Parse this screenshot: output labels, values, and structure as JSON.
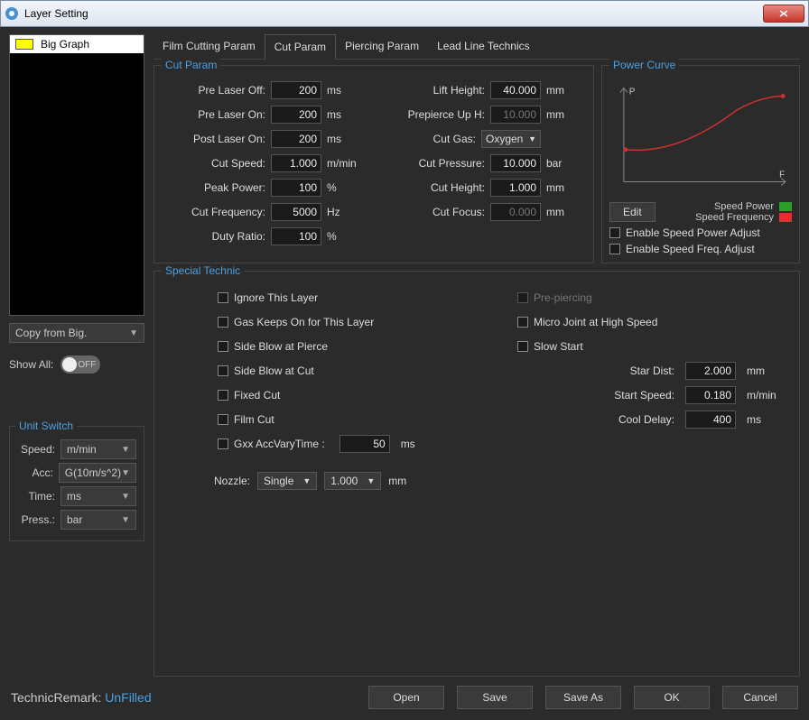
{
  "window": {
    "title": "Layer Setting",
    "close": "X"
  },
  "sidebar": {
    "layer_name": "Big Graph",
    "layer_color": "#ffff00",
    "copy_from": "Copy from Big.",
    "show_all_label": "Show All:",
    "show_all_state": "OFF",
    "unit_switch_legend": "Unit Switch",
    "units": {
      "speed_label": "Speed:",
      "speed_value": "m/min",
      "acc_label": "Acc:",
      "acc_value": "G(10m/s^2)",
      "time_label": "Time:",
      "time_value": "ms",
      "press_label": "Press.:",
      "press_value": "bar"
    }
  },
  "tabs": {
    "t0": "Film Cutting Param",
    "t1": "Cut Param",
    "t2": "Piercing Param",
    "t3": "Lead Line Technics"
  },
  "cut_param": {
    "legend": "Cut Param",
    "left": {
      "pre_laser_off": {
        "label": "Pre Laser Off:",
        "value": "200",
        "unit": "ms"
      },
      "pre_laser_on": {
        "label": "Pre Laser On:",
        "value": "200",
        "unit": "ms"
      },
      "post_laser_on": {
        "label": "Post Laser On:",
        "value": "200",
        "unit": "ms"
      },
      "cut_speed": {
        "label": "Cut Speed:",
        "value": "1.000",
        "unit": "m/min"
      },
      "peak_power": {
        "label": "Peak Power:",
        "value": "100",
        "unit": "%"
      },
      "cut_frequency": {
        "label": "Cut Frequency:",
        "value": "5000",
        "unit": "Hz"
      },
      "duty_ratio": {
        "label": "Duty Ratio:",
        "value": "100",
        "unit": "%"
      }
    },
    "right": {
      "lift_height": {
        "label": "Lift Height:",
        "value": "40.000",
        "unit": "mm"
      },
      "prepierce_up_h": {
        "label": "Prepierce Up H:",
        "value": "10.000",
        "unit": "mm",
        "disabled": true
      },
      "cut_gas": {
        "label": "Cut Gas:",
        "value": "Oxygen"
      },
      "cut_pressure": {
        "label": "Cut Pressure:",
        "value": "10.000",
        "unit": "bar"
      },
      "cut_height": {
        "label": "Cut Height:",
        "value": "1.000",
        "unit": "mm"
      },
      "cut_focus": {
        "label": "Cut Focus:",
        "value": "0.000",
        "unit": "mm",
        "disabled": true
      }
    }
  },
  "power_curve": {
    "legend": "Power Curve",
    "axis_y": "P",
    "axis_x": "F",
    "edit": "Edit",
    "line1_label": "Speed Power",
    "line1_color": "#2aa02a",
    "line2_label": "Speed Frequency",
    "line2_color": "#e03030",
    "enable_power": "Enable Speed Power Adjust",
    "enable_freq": "Enable Speed Freq. Adjust"
  },
  "special": {
    "legend": "Special Technic",
    "left": {
      "ignore": "Ignore This Layer",
      "gas_keeps": "Gas Keeps On for This Layer",
      "side_blow_pierce": "Side Blow at Pierce",
      "side_blow_cut": "Side Blow at Cut",
      "fixed_cut": "Fixed Cut",
      "film_cut": "Film Cut",
      "gxx_label": "Gxx AccVaryTime :",
      "gxx_value": "50",
      "gxx_unit": "ms"
    },
    "right": {
      "pre_piercing": "Pre-piercing",
      "micro_joint": "Micro Joint at High Speed",
      "slow_start": "Slow Start",
      "star_dist": {
        "label": "Star Dist:",
        "value": "2.000",
        "unit": "mm"
      },
      "start_speed": {
        "label": "Start Speed:",
        "value": "0.180",
        "unit": "m/min"
      },
      "cool_delay": {
        "label": "Cool Delay:",
        "value": "400",
        "unit": "ms"
      }
    },
    "nozzle": {
      "label": "Nozzle:",
      "type": "Single",
      "size": "1.000",
      "unit": "mm"
    }
  },
  "footer": {
    "technic_label": "TechnicRemark:",
    "technic_value": "UnFilled",
    "open": "Open",
    "save": "Save",
    "save_as": "Save As",
    "ok": "OK",
    "cancel": "Cancel"
  }
}
